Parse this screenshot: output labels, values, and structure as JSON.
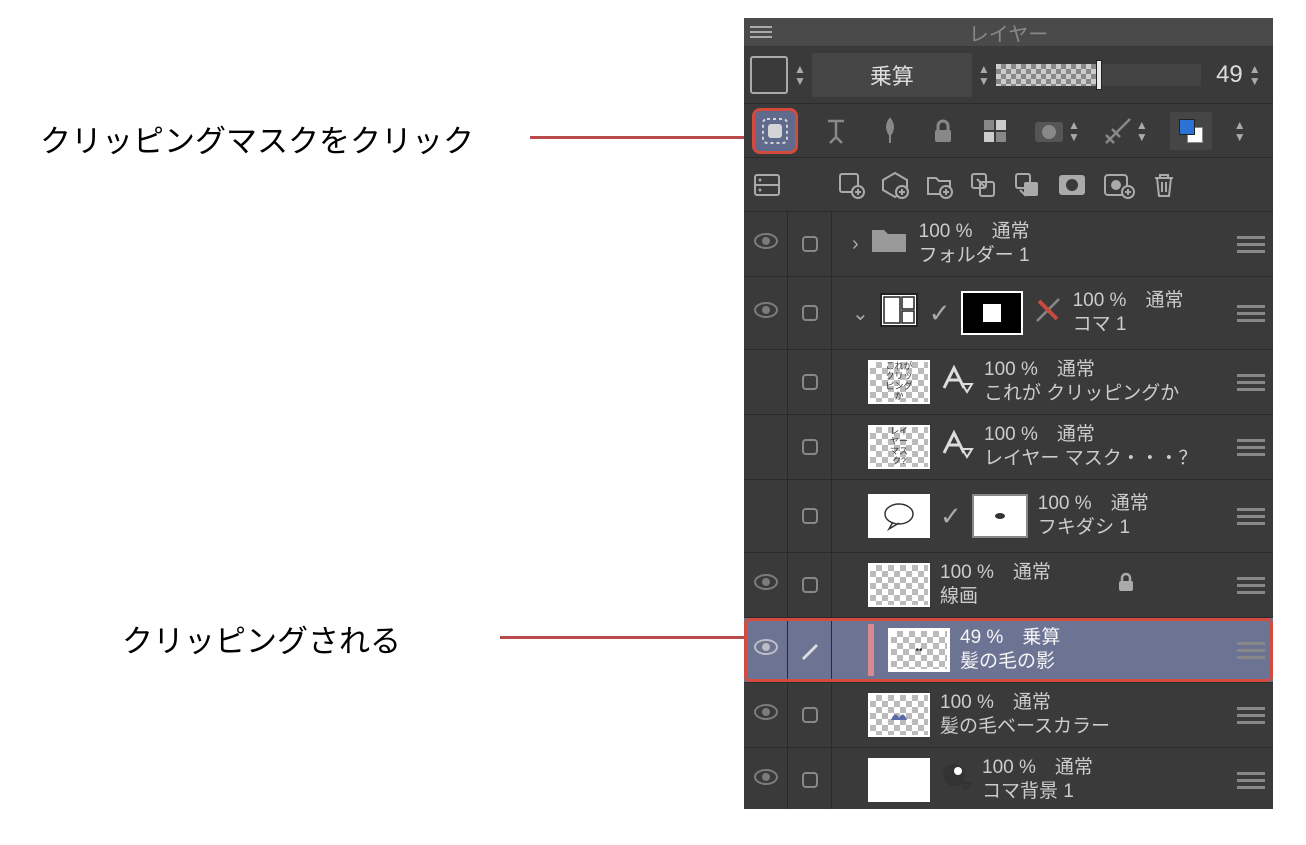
{
  "panel": {
    "title": "レイヤー"
  },
  "header": {
    "blend_mode": "乗算",
    "opacity_value": "49",
    "opacity_pct": 49
  },
  "annotations": {
    "clip_click": "クリッピングマスクをクリック",
    "clipped": "クリッピングされる"
  },
  "layers": [
    {
      "vis": true,
      "type": "folder",
      "expand": "closed",
      "opacity": "100 %",
      "blend": "通常",
      "name": "フォルダー 1"
    },
    {
      "vis": true,
      "type": "koma",
      "expand": "open",
      "opacity": "100 %",
      "blend": "通常",
      "name": "コマ 1"
    },
    {
      "vis": false,
      "type": "text",
      "opacity": "100 %",
      "blend": "通常",
      "name": "これが クリッピングか"
    },
    {
      "vis": false,
      "type": "text",
      "opacity": "100 %",
      "blend": "通常",
      "name": "レイヤー マスク・・・？"
    },
    {
      "vis": false,
      "type": "balloon",
      "opacity": "100 %",
      "blend": "通常",
      "name": "フキダシ 1"
    },
    {
      "vis": true,
      "type": "line",
      "locked": true,
      "opacity": "100 %",
      "blend": "通常",
      "name": "線画"
    },
    {
      "vis": true,
      "type": "selected",
      "opacity": "49 %",
      "blend": "乗算",
      "name": "髪の毛の影"
    },
    {
      "vis": true,
      "type": "normal",
      "opacity": "100 %",
      "blend": "通常",
      "name": "髪の毛ベースカラー"
    },
    {
      "vis": true,
      "type": "bg",
      "opacity": "100 %",
      "blend": "通常",
      "name": "コマ背景 1"
    }
  ]
}
